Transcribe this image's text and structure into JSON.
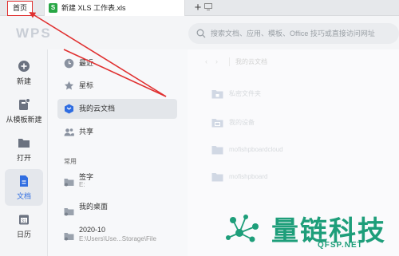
{
  "tabs": {
    "home_label": "首页",
    "doc_title": "新建 XLS 工作表.xls",
    "doc_icon_letter": "S",
    "add_label": "+"
  },
  "header": {
    "logo_text": "WPS",
    "search_placeholder": "搜索文档、应用、模板、Office 技巧或直接访问网址"
  },
  "rail": {
    "items": [
      {
        "label": "新建",
        "icon": "plus-circle-icon"
      },
      {
        "label": "从模板新建",
        "icon": "template-icon"
      },
      {
        "label": "打开",
        "icon": "folder-open-icon"
      },
      {
        "label": "文档",
        "icon": "document-icon",
        "active": true
      },
      {
        "label": "日历",
        "icon": "calendar-icon"
      }
    ]
  },
  "nav": {
    "items": [
      {
        "label": "最近",
        "icon": "clock-icon"
      },
      {
        "label": "星标",
        "icon": "star-icon"
      },
      {
        "label": "我的云文档",
        "icon": "cloud-doc-icon",
        "active": true
      },
      {
        "label": "共享",
        "icon": "share-users-icon"
      }
    ],
    "section_label": "常用",
    "more_label": "⋮",
    "places": [
      {
        "name": "签字",
        "path": "E:"
      },
      {
        "name": "我的桌面",
        "path": ""
      },
      {
        "name": "2020-10",
        "path": "E:\\Users\\Use...Storage\\File"
      }
    ]
  },
  "main": {
    "breadcrumb": "我的云文档",
    "back": "‹",
    "forward": "›",
    "files": [
      {
        "name": "私密文件夹",
        "icon": "lock-folder-icon"
      },
      {
        "name": "我的设备",
        "icon": "device-folder-icon"
      },
      {
        "name": "mofishpboardcloud",
        "icon": "folder-icon"
      },
      {
        "name": "mofishpboard",
        "icon": "folder-icon"
      }
    ]
  },
  "watermark": {
    "title": "量链科技",
    "url": "QFSP.NET"
  },
  "colors": {
    "accent": "#2f6de1",
    "annotation": "#e03030",
    "watermark": "#1e9e7a",
    "xls_green": "#28a745"
  }
}
